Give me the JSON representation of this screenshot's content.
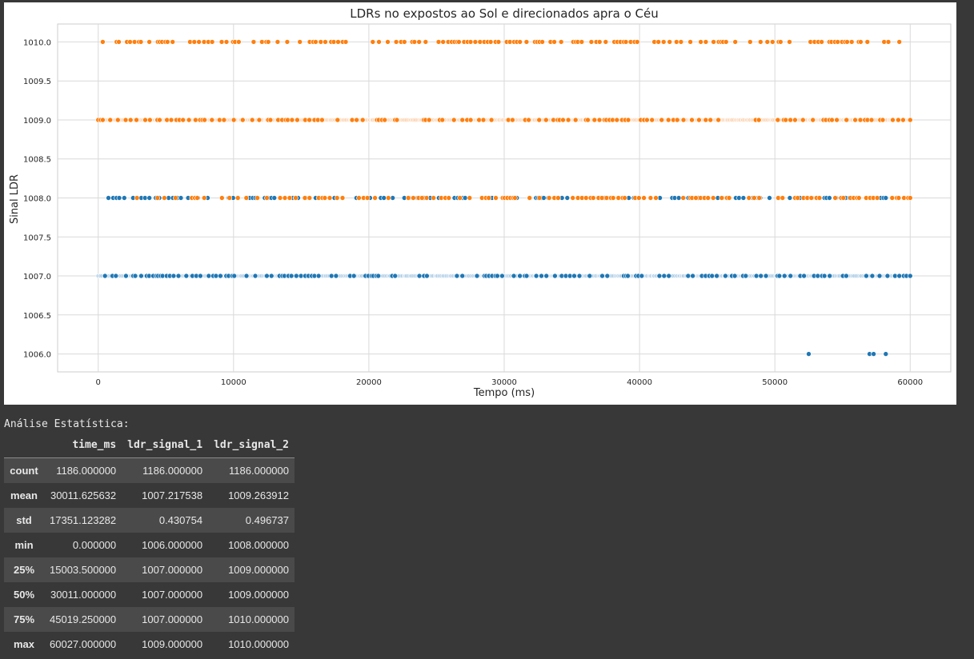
{
  "chart_data": {
    "type": "scatter",
    "title": "LDRs no expostos ao Sol e direcionados apra o Céu",
    "xlabel": "Tempo (ms)",
    "ylabel": "Sinal LDR",
    "xlim": [
      -3000,
      63000
    ],
    "ylim": [
      1005.77,
      1010.23
    ],
    "xticks": [
      0,
      10000,
      20000,
      30000,
      40000,
      50000,
      60000
    ],
    "yticks": [
      1006.0,
      1006.5,
      1007.0,
      1007.5,
      1008.0,
      1008.5,
      1009.0,
      1009.5,
      1010.0
    ],
    "grid": true,
    "legend": "none",
    "series": [
      {
        "color": "#a6c8e4",
        "y": 1007.0,
        "x_range": [
          0,
          60000
        ],
        "dense": true
      },
      {
        "color": "#fbd0ad",
        "y": 1009.0,
        "x_range": [
          0,
          60000
        ],
        "dense": true
      },
      {
        "color": "#1f77b4",
        "y": 1007.0,
        "x_range": [
          500,
          60000
        ]
      },
      {
        "color": "#1f77b4",
        "y": 1008.0,
        "x_range": [
          600,
          58200
        ]
      },
      {
        "color": "#1f77b4",
        "y": 1006.0,
        "x": [
          52500,
          57000,
          57300,
          58200
        ]
      },
      {
        "color": "#ff7f0e",
        "y": 1010.0,
        "x_range": [
          100,
          59200
        ]
      },
      {
        "color": "#ff7f0e",
        "y": 1009.0,
        "x_range": [
          0,
          60000
        ]
      },
      {
        "color": "#ff7f0e",
        "y": 1008.0,
        "x_range": [
          2600,
          60000
        ]
      }
    ]
  },
  "stats": {
    "heading": "Análise Estatística:",
    "columns": [
      "",
      "time_ms",
      "ldr_signal_1",
      "ldr_signal_2"
    ],
    "rows": [
      [
        "count",
        "1186.000000",
        "1186.000000",
        "1186.000000"
      ],
      [
        "mean",
        "30011.625632",
        "1007.217538",
        "1009.263912"
      ],
      [
        "std",
        "17351.123282",
        "0.430754",
        "0.496737"
      ],
      [
        "min",
        "0.000000",
        "1006.000000",
        "1008.000000"
      ],
      [
        "25%",
        "15003.500000",
        "1007.000000",
        "1009.000000"
      ],
      [
        "50%",
        "30011.000000",
        "1007.000000",
        "1009.000000"
      ],
      [
        "75%",
        "45019.250000",
        "1007.000000",
        "1010.000000"
      ],
      [
        "max",
        "60027.000000",
        "1009.000000",
        "1010.000000"
      ]
    ]
  }
}
